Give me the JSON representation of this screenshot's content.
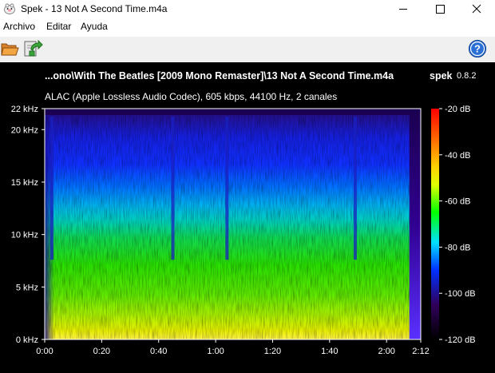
{
  "window": {
    "title": "Spek - 13 Not A Second Time.m4a",
    "controls": {
      "minimize": "–",
      "maximize": "☐",
      "close": "✕"
    }
  },
  "menu": {
    "items": [
      {
        "label": "Archivo"
      },
      {
        "label": "Editar"
      },
      {
        "label": "Ayuda"
      }
    ]
  },
  "toolbar": {
    "buttons": [
      {
        "name": "open-file",
        "icon": "folder-open-icon"
      },
      {
        "name": "save-image",
        "icon": "save-arrow-icon"
      },
      {
        "name": "help",
        "icon": "help-icon",
        "label": "?"
      }
    ]
  },
  "spectrogram": {
    "file_name": "...ono\\With The Beatles [2009 Mono Remaster]\\13 Not A Second Time.m4a",
    "app_name": "spek",
    "app_version": "0.8.2",
    "stream_info": "ALAC (Apple Lossless Audio Codec), 605 kbps, 44100 Hz, 2 canales",
    "colors": {
      "background": "#000000",
      "axis": "#ffffff"
    }
  },
  "chart_data": {
    "type": "heatmap",
    "title": "...ono\\With The Beatles [2009 Mono Remaster]\\13 Not A Second Time.m4a",
    "xlabel": "",
    "ylabel": "",
    "x_range_seconds": [
      0,
      132
    ],
    "y_range_khz": [
      0,
      22
    ],
    "x_ticks": [
      "0:00",
      "0:20",
      "0:40",
      "1:00",
      "1:20",
      "1:40",
      "2:00",
      "2:12"
    ],
    "x_tick_values": [
      0,
      20,
      40,
      60,
      80,
      100,
      120,
      132
    ],
    "y_ticks": [
      "0 kHz",
      "5 kHz",
      "10 kHz",
      "15 kHz",
      "20 kHz",
      "22 kHz"
    ],
    "y_tick_values": [
      0,
      5,
      10,
      15,
      20,
      22
    ],
    "colorbar": {
      "labels": [
        "-20 dB",
        "-40 dB",
        "-60 dB",
        "-80 dB",
        "-100 dB",
        "-120 dB"
      ],
      "values": [
        -20,
        -40,
        -60,
        -80,
        -100,
        -120
      ],
      "colors": [
        "#ff0000",
        "#ffa500",
        "#ffff00",
        "#00ff00",
        "#00e0ff",
        "#0000ff",
        "#30005a",
        "#000000"
      ]
    },
    "audio_end_seconds": 128,
    "dips_seconds": [
      2.5,
      45,
      64,
      109
    ],
    "band_levels_db": [
      {
        "khz": 0,
        "db": -28
      },
      {
        "khz": 1.5,
        "db": -38
      },
      {
        "khz": 3,
        "db": -48
      },
      {
        "khz": 5,
        "db": -54
      },
      {
        "khz": 8,
        "db": -60
      },
      {
        "khz": 11,
        "db": -66
      },
      {
        "khz": 13,
        "db": -76
      },
      {
        "khz": 15,
        "db": -84
      },
      {
        "khz": 17,
        "db": -94
      },
      {
        "khz": 20,
        "db": -100
      },
      {
        "khz": 22,
        "db": -104
      }
    ]
  }
}
